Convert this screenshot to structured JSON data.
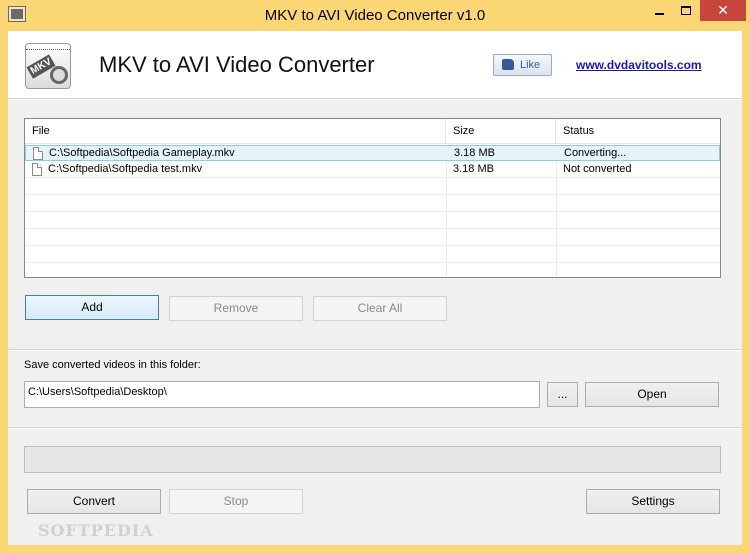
{
  "window": {
    "title": "MKV to AVI Video Converter v1.0",
    "minimize_glyph": "",
    "close_glyph": "✕",
    "frame_color": "#fbd675"
  },
  "header": {
    "logo_text": "MKV",
    "app_name": "MKV to AVI Video Converter",
    "like_label": "Like",
    "site_link": "www.dvdavitools.com"
  },
  "file_list": {
    "columns": {
      "file": "File",
      "size": "Size",
      "status": "Status"
    },
    "rows": [
      {
        "file": "C:\\Softpedia\\Softpedia Gameplay.mkv",
        "size": "3.18 MB",
        "status": "Converting..."
      },
      {
        "file": "C:\\Softpedia\\Softpedia test.mkv",
        "size": "3.18 MB",
        "status": "Not converted"
      }
    ]
  },
  "list_buttons": {
    "add": "Add",
    "remove": "Remove",
    "clear_all": "Clear All"
  },
  "output": {
    "label": "Save converted videos in this folder:",
    "folder": "C:\\Users\\Softpedia\\Desktop\\",
    "browse": "...",
    "open": "Open"
  },
  "progress": {
    "value": 0
  },
  "actions": {
    "convert": "Convert",
    "stop": "Stop",
    "settings": "Settings"
  },
  "watermark": "SOFTPEDIA"
}
